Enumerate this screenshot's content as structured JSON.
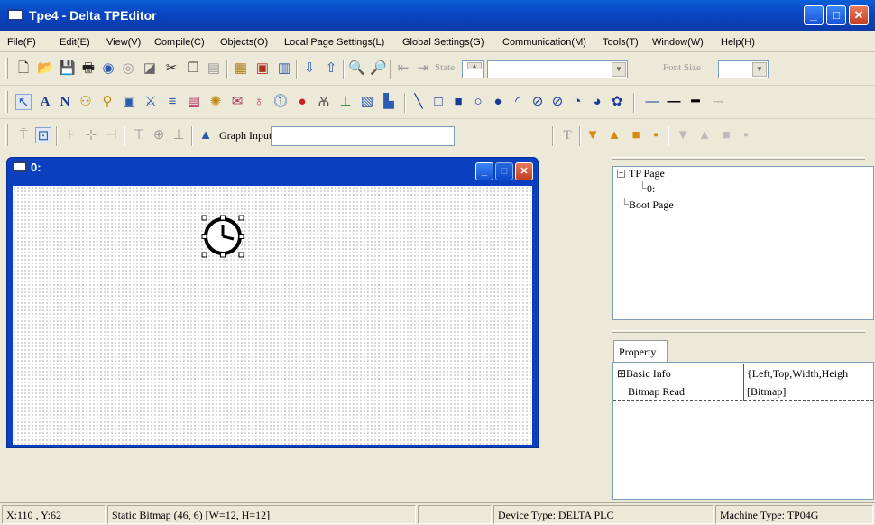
{
  "window": {
    "title": "Tpe4 - Delta TPEditor"
  },
  "menu": [
    "File(F)",
    "Edit(E)",
    "View(V)",
    "Compile(C)",
    "Objects(O)",
    "Local Page Settings(L)",
    "Global Settings(G)",
    "Communication(M)",
    "Tools(T)",
    "Window(W)",
    "Help(H)"
  ],
  "toolbar1": {
    "state_label": "State",
    "font_size_label": "Font Size"
  },
  "toolbar3": {
    "graph_input_label": "Graph Input:",
    "graph_input_value": ""
  },
  "child_window": {
    "title": "0:"
  },
  "tree": {
    "root": "TP Page",
    "child": "0:",
    "boot": "Boot Page"
  },
  "property": {
    "tab": "Property",
    "rows": [
      {
        "key": "⊞Basic Info",
        "value": "{Left,Top,Width,Heigh"
      },
      {
        "key": "Bitmap Read",
        "value": "[Bitmap]"
      }
    ]
  },
  "status": {
    "coords": "X:110 , Y:62",
    "object": "Static Bitmap (46, 6) [W=12, H=12]",
    "device": "Device Type: DELTA PLC",
    "machine": "Machine Type: TP04G"
  }
}
